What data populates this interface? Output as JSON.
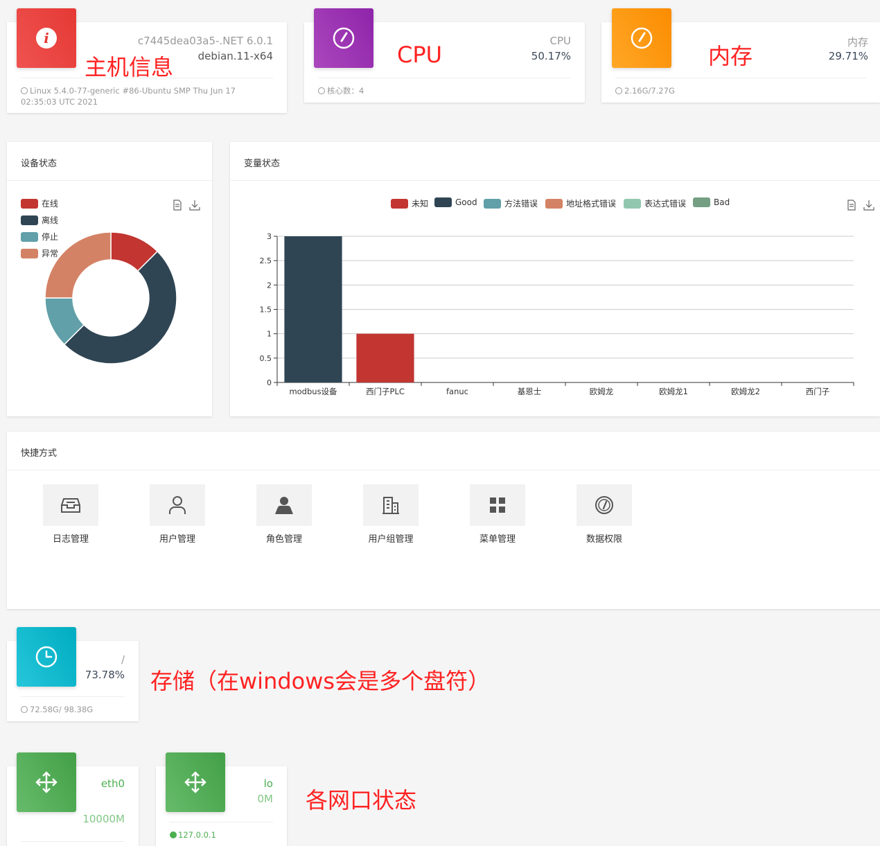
{
  "host": {
    "line1": "c7445dea03a5-.NET 6.0.1",
    "line2": "debian.11-x64",
    "footer": "Linux 5.4.0-77-generic #86-Ubuntu SMP Thu Jun 17 02:35:03 UTC 2021",
    "annotation": "主机信息",
    "color": "#e53935"
  },
  "cpu": {
    "category": "CPU",
    "value": "50.17%",
    "footer": "核心数：4",
    "annotation": "CPU",
    "color": "#8e24aa"
  },
  "memory": {
    "category": "内存",
    "value": "29.71%",
    "footer": "2.16G/7.27G",
    "annotation": "内存",
    "color": "#fb8c00"
  },
  "device_status": {
    "title": "设备状态",
    "legend": [
      {
        "label": "在线",
        "color": "#c23531"
      },
      {
        "label": "离线",
        "color": "#2f4554"
      },
      {
        "label": "停止",
        "color": "#61a0a8"
      },
      {
        "label": "异常",
        "color": "#d48265"
      }
    ]
  },
  "variable_status": {
    "title": "变量状态",
    "legend": [
      {
        "label": "未知",
        "color": "#c23531"
      },
      {
        "label": "Good",
        "color": "#2f4554"
      },
      {
        "label": "方法错误",
        "color": "#61a0a8"
      },
      {
        "label": "地址格式错误",
        "color": "#d48265"
      },
      {
        "label": "表达式错误",
        "color": "#91c7ae"
      },
      {
        "label": "Bad",
        "color": "#749f83"
      }
    ]
  },
  "chart_data": [
    {
      "type": "pie",
      "donut": true,
      "title": "设备状态",
      "labels": [
        "在线",
        "离线",
        "停止",
        "异常"
      ],
      "values": [
        1,
        4,
        1,
        2
      ],
      "colors": [
        "#c23531",
        "#2f4554",
        "#61a0a8",
        "#d48265"
      ],
      "legend": "top-left"
    },
    {
      "type": "bar",
      "title": "变量状态",
      "categories": [
        "modbus设备",
        "西门子PLC",
        "fanuc",
        "基恩士",
        "欧姆龙",
        "欧姆龙1",
        "欧姆龙2",
        "西门子"
      ],
      "series": [
        {
          "name": "未知",
          "color": "#c23531",
          "values": [
            0,
            1,
            0,
            0,
            0,
            0,
            0,
            0
          ]
        },
        {
          "name": "Good",
          "color": "#2f4554",
          "values": [
            3,
            0,
            0,
            0,
            0,
            0,
            0,
            0
          ]
        },
        {
          "name": "方法错误",
          "color": "#61a0a8",
          "values": [
            0,
            0,
            0,
            0,
            0,
            0,
            0,
            0
          ]
        },
        {
          "name": "地址格式错误",
          "color": "#d48265",
          "values": [
            0,
            0,
            0,
            0,
            0,
            0,
            0,
            0
          ]
        },
        {
          "name": "表达式错误",
          "color": "#91c7ae",
          "values": [
            0,
            0,
            0,
            0,
            0,
            0,
            0,
            0
          ]
        },
        {
          "name": "Bad",
          "color": "#749f83",
          "values": [
            0,
            0,
            0,
            0,
            0,
            0,
            0,
            0
          ]
        }
      ],
      "yticks": [
        "0",
        "0.5",
        "1",
        "1.5",
        "2",
        "2.5",
        "3"
      ],
      "ylim": [
        0,
        3
      ],
      "grid": true,
      "legend": "top-center",
      "stacked": true
    }
  ],
  "shortcuts": {
    "title": "快捷方式",
    "items": [
      {
        "label": "日志管理",
        "icon": "inbox-icon"
      },
      {
        "label": "用户管理",
        "icon": "user-outline-icon"
      },
      {
        "label": "角色管理",
        "icon": "user-solid-icon"
      },
      {
        "label": "用户组管理",
        "icon": "building-icon"
      },
      {
        "label": "菜单管理",
        "icon": "grid-icon"
      },
      {
        "label": "数据权限",
        "icon": "dashboard-icon"
      }
    ]
  },
  "storage": {
    "category": "/",
    "value": "73.78%",
    "footer": "72.58G/ 98.38G",
    "annotation": "存储（在windows会是多个盘符）",
    "color": "#00acc1"
  },
  "network": {
    "annotation": "各网口状态",
    "color": "#43a047",
    "text_color": "#4caf50",
    "ifaces": [
      {
        "name": "eth0",
        "speed": "10000M",
        "ip": ""
      },
      {
        "name": "lo",
        "speed": "0M",
        "ip": "127.0.0.1"
      }
    ]
  }
}
